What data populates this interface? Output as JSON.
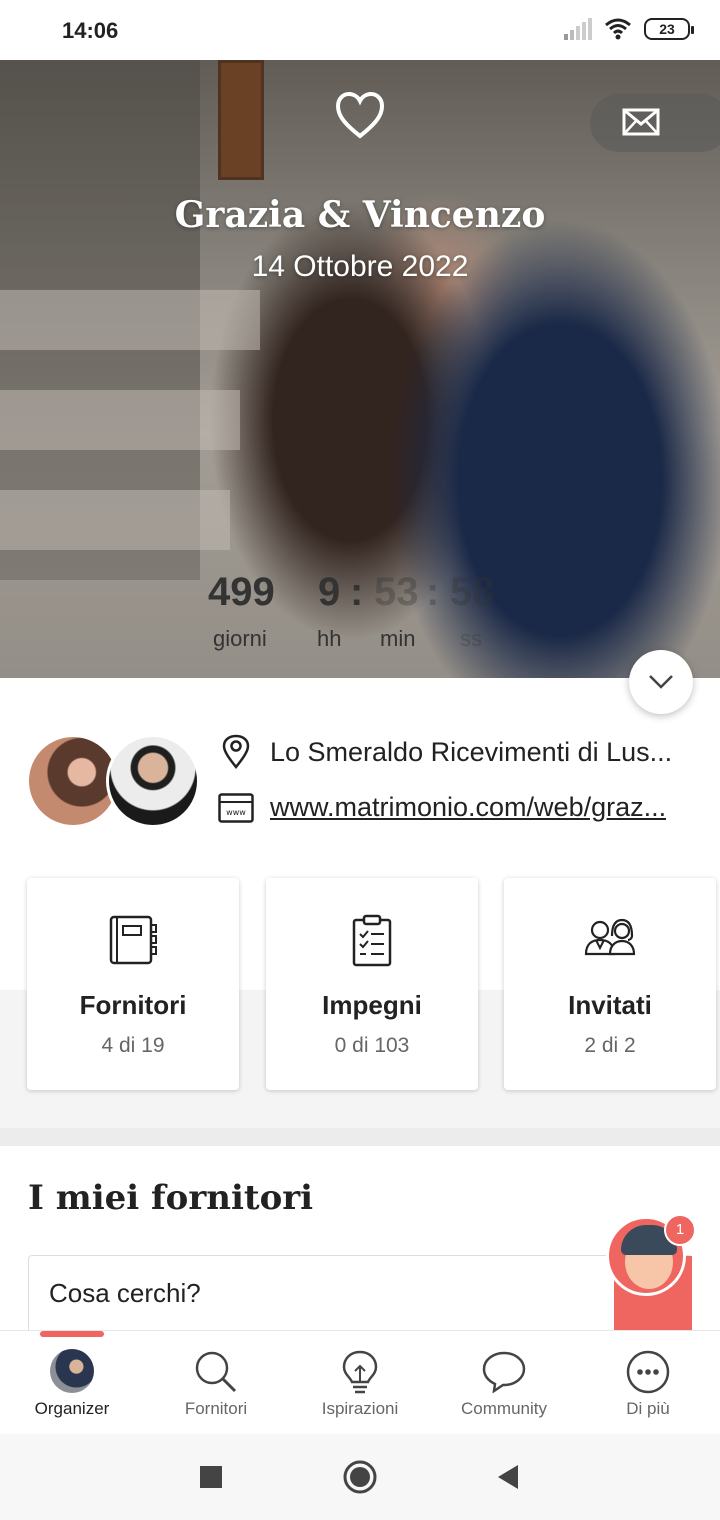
{
  "status_bar": {
    "time": "14:06",
    "battery": "23"
  },
  "hero": {
    "couple_name": "Grazia & Vincenzo",
    "wedding_date": "14 Ottobre 2022",
    "countdown": [
      {
        "value": "499",
        "label": "giorni"
      },
      {
        "value": "9",
        "label": "hh"
      },
      {
        "value": "53",
        "label": "min"
      },
      {
        "value": "58",
        "label": "ss"
      }
    ],
    "countdown_separator": ":"
  },
  "info": {
    "venue": "Lo Smeraldo Ricevimenti di Lus...",
    "website": "www.matrimonio.com/web/graz..."
  },
  "cards": [
    {
      "title": "Fornitori",
      "count": "4 di 19",
      "icon": "notebook-icon"
    },
    {
      "title": "Impegni",
      "count": "0 di 103",
      "icon": "checklist-icon"
    },
    {
      "title": "Invitati",
      "count": "2 di 2",
      "icon": "guests-icon"
    }
  ],
  "suppliers_section": {
    "title": "I miei fornitori",
    "search_placeholder": "Cosa cerchi?"
  },
  "help": {
    "badge": "1"
  },
  "bottom_nav": [
    {
      "label": "Organizer",
      "icon": "avatar",
      "active": true
    },
    {
      "label": "Fornitori",
      "icon": "search-icon",
      "active": false
    },
    {
      "label": "Ispirazioni",
      "icon": "lightbulb-icon",
      "active": false
    },
    {
      "label": "Community",
      "icon": "chat-bubble-icon",
      "active": false
    },
    {
      "label": "Di più",
      "icon": "more-icon",
      "active": false
    }
  ],
  "colors": {
    "accent": "#ef6560",
    "text": "#222222",
    "muted": "#666666"
  }
}
